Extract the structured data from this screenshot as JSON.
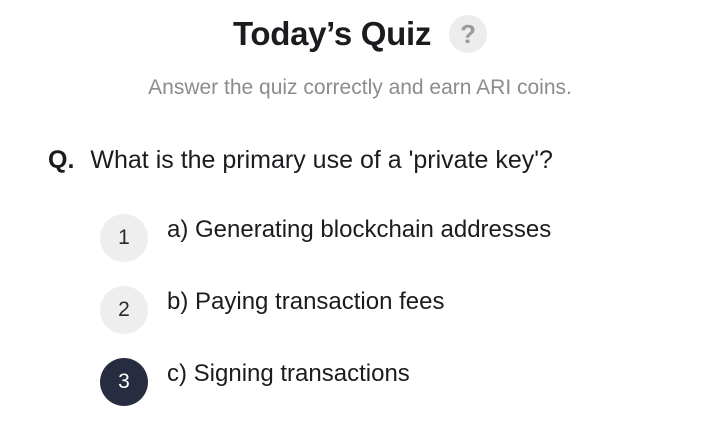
{
  "header": {
    "title": "Today’s Quiz",
    "help_symbol": "?"
  },
  "subtitle": "Answer the quiz correctly and earn ARI coins.",
  "question": {
    "prefix": "Q.",
    "text": "What is the primary use of a 'private key'?"
  },
  "options": [
    {
      "number": "1",
      "label": "a) Generating blockchain addresses",
      "selected": false
    },
    {
      "number": "2",
      "label": "b) Paying transaction fees",
      "selected": false
    },
    {
      "number": "3",
      "label": "c) Signing transactions",
      "selected": true
    }
  ],
  "colors": {
    "selected": "#272c40",
    "unselected": "#eeeeee",
    "muted_text": "#8c8c8c"
  },
  "icons": {
    "help": "question-mark-icon"
  }
}
